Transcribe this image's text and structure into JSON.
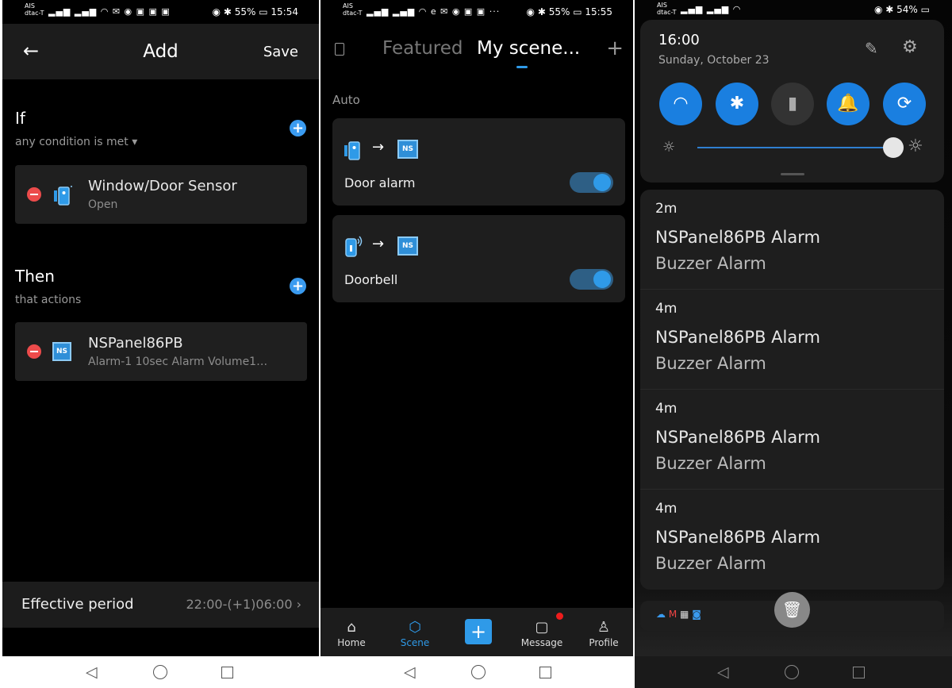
{
  "panel1": {
    "status": {
      "carrier": "AIS\ndtac-T",
      "battery": "55%",
      "time": "15:54"
    },
    "header": {
      "back": "←",
      "title": "Add",
      "save": "Save"
    },
    "if_section": {
      "title": "If",
      "subtitle": "any condition is met ▾"
    },
    "if_card": {
      "name": "Window/Door Sensor",
      "desc": "Open"
    },
    "then_section": {
      "title": "Then",
      "subtitle": "that actions"
    },
    "then_card": {
      "name": "NSPanel86PB",
      "desc": "Alarm-1   10sec   Alarm Volume1…",
      "icon_text": "NS"
    },
    "effective": {
      "label": "Effective period",
      "value": "22:00-(+1)06:00 ›"
    }
  },
  "panel2": {
    "status": {
      "carrier": "AIS\ndtac-T",
      "battery": "55%",
      "time": "15:55"
    },
    "tabs": {
      "featured": "Featured",
      "my_scene": "My scene..."
    },
    "plus": "+",
    "section_label": "Auto",
    "scenes": [
      {
        "label": "Door alarm",
        "icon_text": "NS",
        "enabled": true
      },
      {
        "label": "Doorbell",
        "icon_text": "NS",
        "enabled": true
      }
    ],
    "tabbar": {
      "home": "Home",
      "scene": "Scene",
      "message": "Message",
      "profile": "Profile",
      "add": "+"
    }
  },
  "panel3": {
    "status": {
      "carrier": "AIS\ndtac-T",
      "battery": "54%"
    },
    "quick": {
      "time": "16:00",
      "date": "Sunday, October 23"
    },
    "brightness_level": 0.95,
    "notifications": [
      {
        "time": "2m",
        "title": "NSPanel86PB Alarm",
        "body": "Buzzer Alarm"
      },
      {
        "time": "4m",
        "title": "NSPanel86PB Alarm",
        "body": "Buzzer Alarm"
      },
      {
        "time": "4m",
        "title": "NSPanel86PB Alarm",
        "body": "Buzzer Alarm"
      },
      {
        "time": "4m",
        "title": "NSPanel86PB Alarm",
        "body": "Buzzer Alarm"
      }
    ]
  },
  "colors": {
    "accent": "#2f9ae8",
    "danger": "#ec4b4b",
    "quick_on": "#1a7fe0"
  }
}
